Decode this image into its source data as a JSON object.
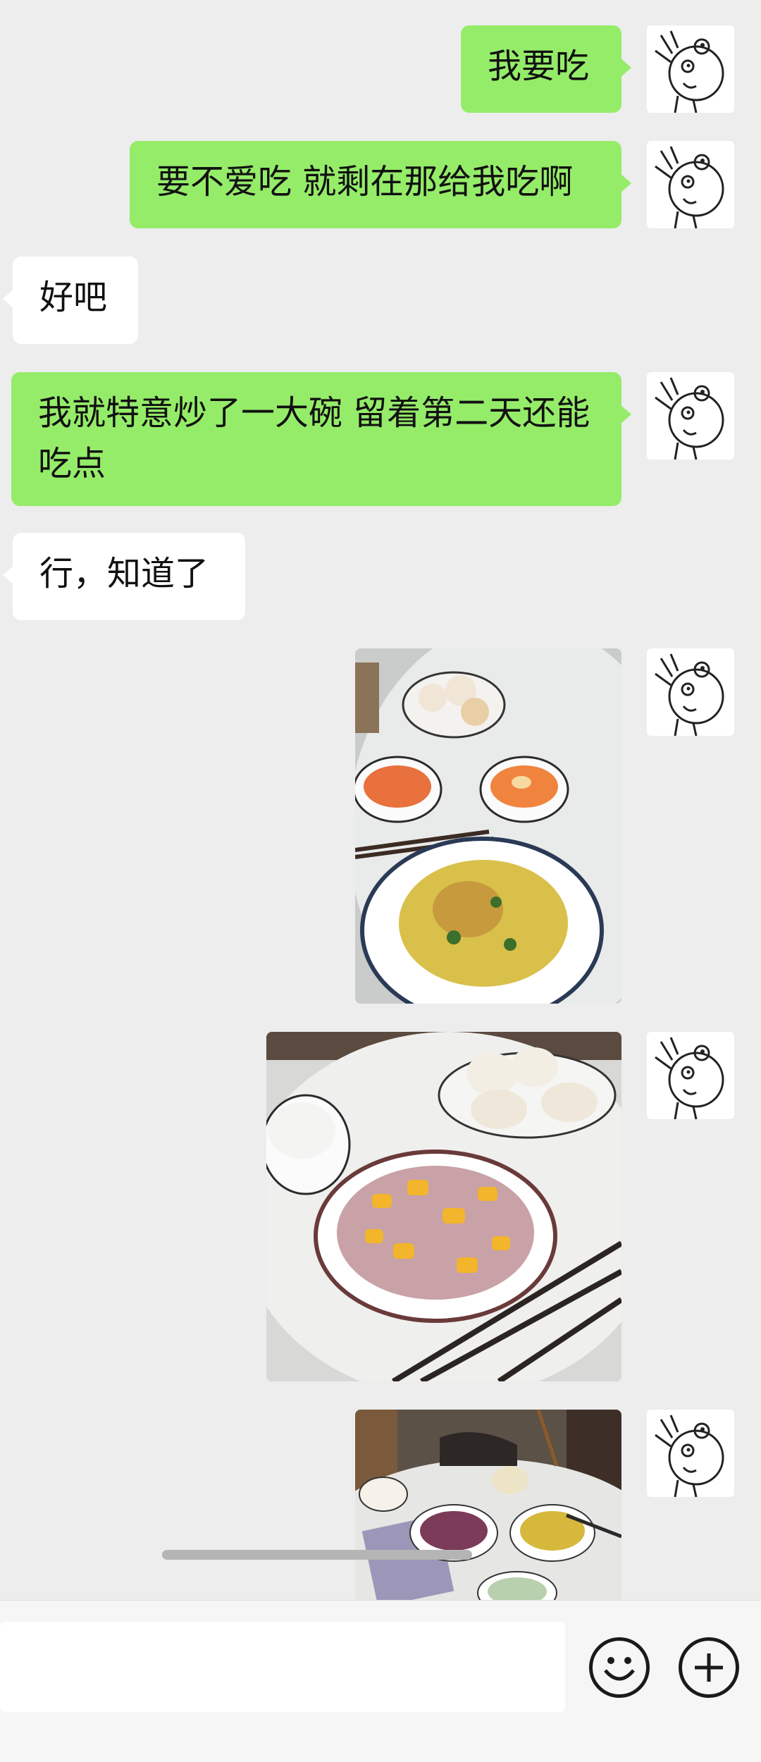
{
  "messages": [
    {
      "side": "me",
      "kind": "text",
      "text": "我要吃"
    },
    {
      "side": "me",
      "kind": "text",
      "text": "要不爱吃 就剩在那给我吃啊"
    },
    {
      "side": "them",
      "kind": "text",
      "text": "好吧"
    },
    {
      "side": "me",
      "kind": "text",
      "text": "我就特意炒了一大碗 留着第二天还能吃点"
    },
    {
      "side": "them",
      "kind": "text",
      "text": "行，知道了"
    },
    {
      "side": "me",
      "kind": "image",
      "subject": "dinner table with buns, two bowls of tomato egg soup and scrambled eggs with chives"
    },
    {
      "side": "me",
      "kind": "image",
      "subject": "dinner table with steamed rolls, rice bowl and stir-fried onion with eggs"
    },
    {
      "side": "me",
      "kind": "image",
      "subject": "family dinner table with several dishes"
    }
  ],
  "avatar_icon": "cartoon-face-icon",
  "input_bar": {
    "placeholder": "",
    "emoji_icon": "emoji-icon",
    "plus_icon": "plus-icon"
  },
  "colors": {
    "background": "#ededed",
    "my_bubble": "#95ec69",
    "their_bubble": "#ffffff"
  }
}
